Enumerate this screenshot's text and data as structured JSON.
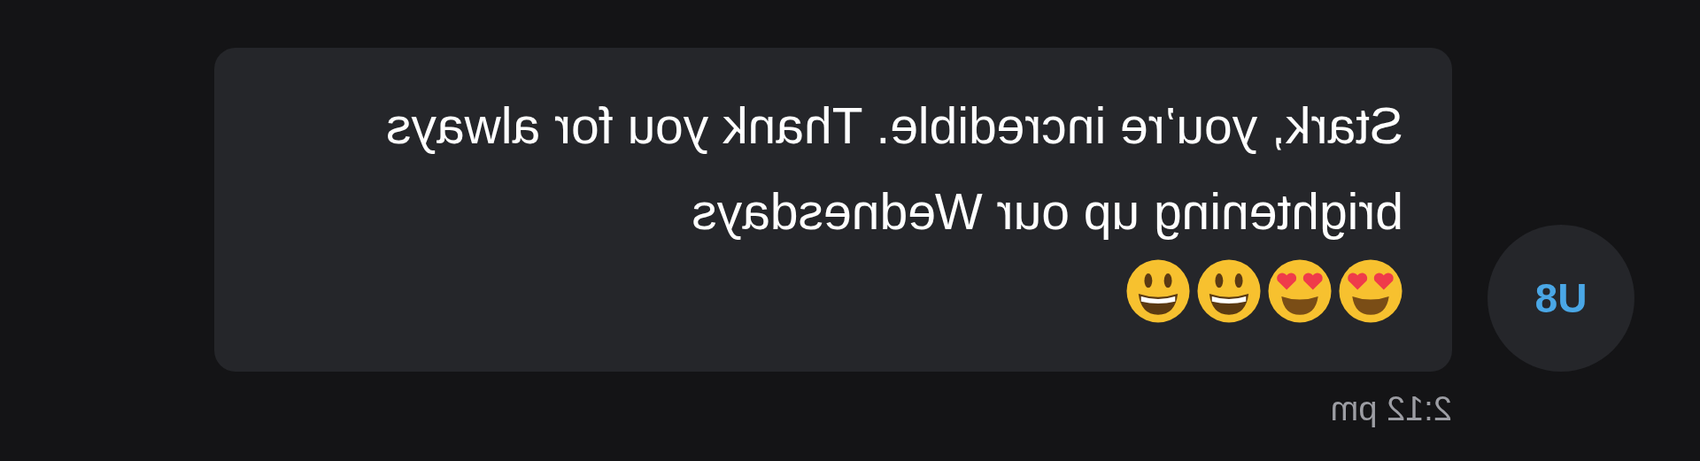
{
  "message": {
    "avatar": "U8",
    "text": "Stark, you’re incredible. Thank you for always brightening up our Wednesdays",
    "emojis": [
      {
        "kind": "heart-eyes"
      },
      {
        "kind": "heart-eyes"
      },
      {
        "kind": "smiley"
      },
      {
        "kind": "smiley"
      }
    ],
    "time": "2:12 pm"
  }
}
